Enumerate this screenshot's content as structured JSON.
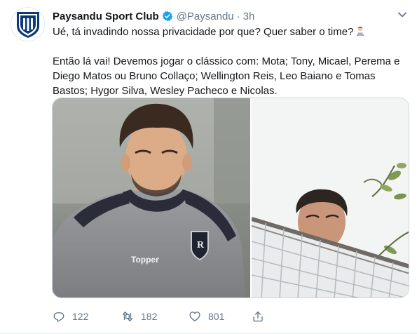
{
  "tweet": {
    "author_name": "Paysandu Sport Club",
    "handle": "@Paysandu",
    "separator": "·",
    "time": "3h",
    "text_line1": "Ué, tá invadindo nossa privacidade por que? Quer saber o time?",
    "text_body": "Então lá vai! Devemos jogar o clássico com: Mota; Tony, Micael, Perema e Diego Matos ou Bruno Collaço; Wellington Reis, Leo Baiano e Tomas Bastos; Hygor Silva, Wesley Pacheco e Nicolas.",
    "emoji": "man-technologist-emoji",
    "jersey_brand": "Topper"
  },
  "actions": {
    "replies": "122",
    "retweets": "182",
    "likes": "801"
  },
  "icons": {
    "verified": "verified-badge-icon",
    "caret": "chevron-down-icon",
    "reply": "reply-icon",
    "retweet": "retweet-icon",
    "like": "heart-icon",
    "share": "share-icon"
  },
  "colors": {
    "brand_blue": "#1da1f2",
    "club_navy": "#0b3a78",
    "muted_text": "#657786",
    "text": "#14171a"
  }
}
